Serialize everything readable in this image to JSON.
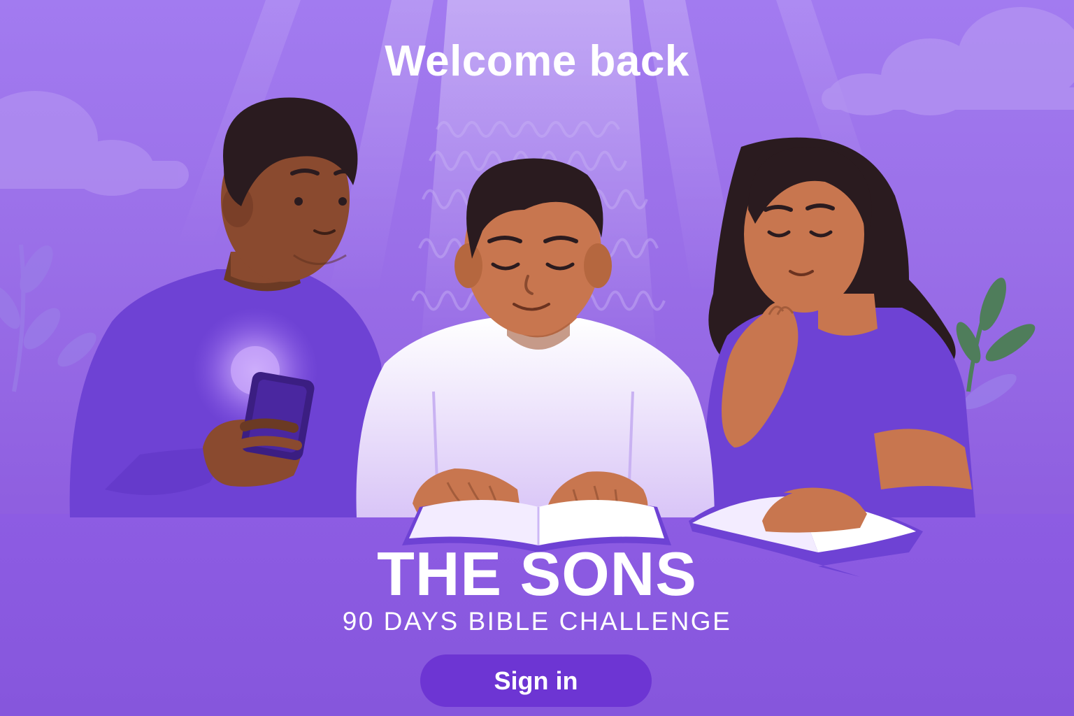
{
  "welcome": {
    "title": "Welcome back"
  },
  "brand": {
    "title": "THE SONS",
    "subtitle": "90 DAYS BIBLE CHALLENGE"
  },
  "actions": {
    "sign_in_label": "Sign in"
  },
  "illustration": {
    "icon": "three-people-reading-bible-illustration",
    "people": [
      "person-with-phone",
      "person-reading-bible",
      "person-resting-chin"
    ]
  },
  "colors": {
    "background_top": "#a27bf0",
    "background_bottom": "#8a58dc",
    "button": "#6d35d3",
    "text": "#ffffff"
  }
}
